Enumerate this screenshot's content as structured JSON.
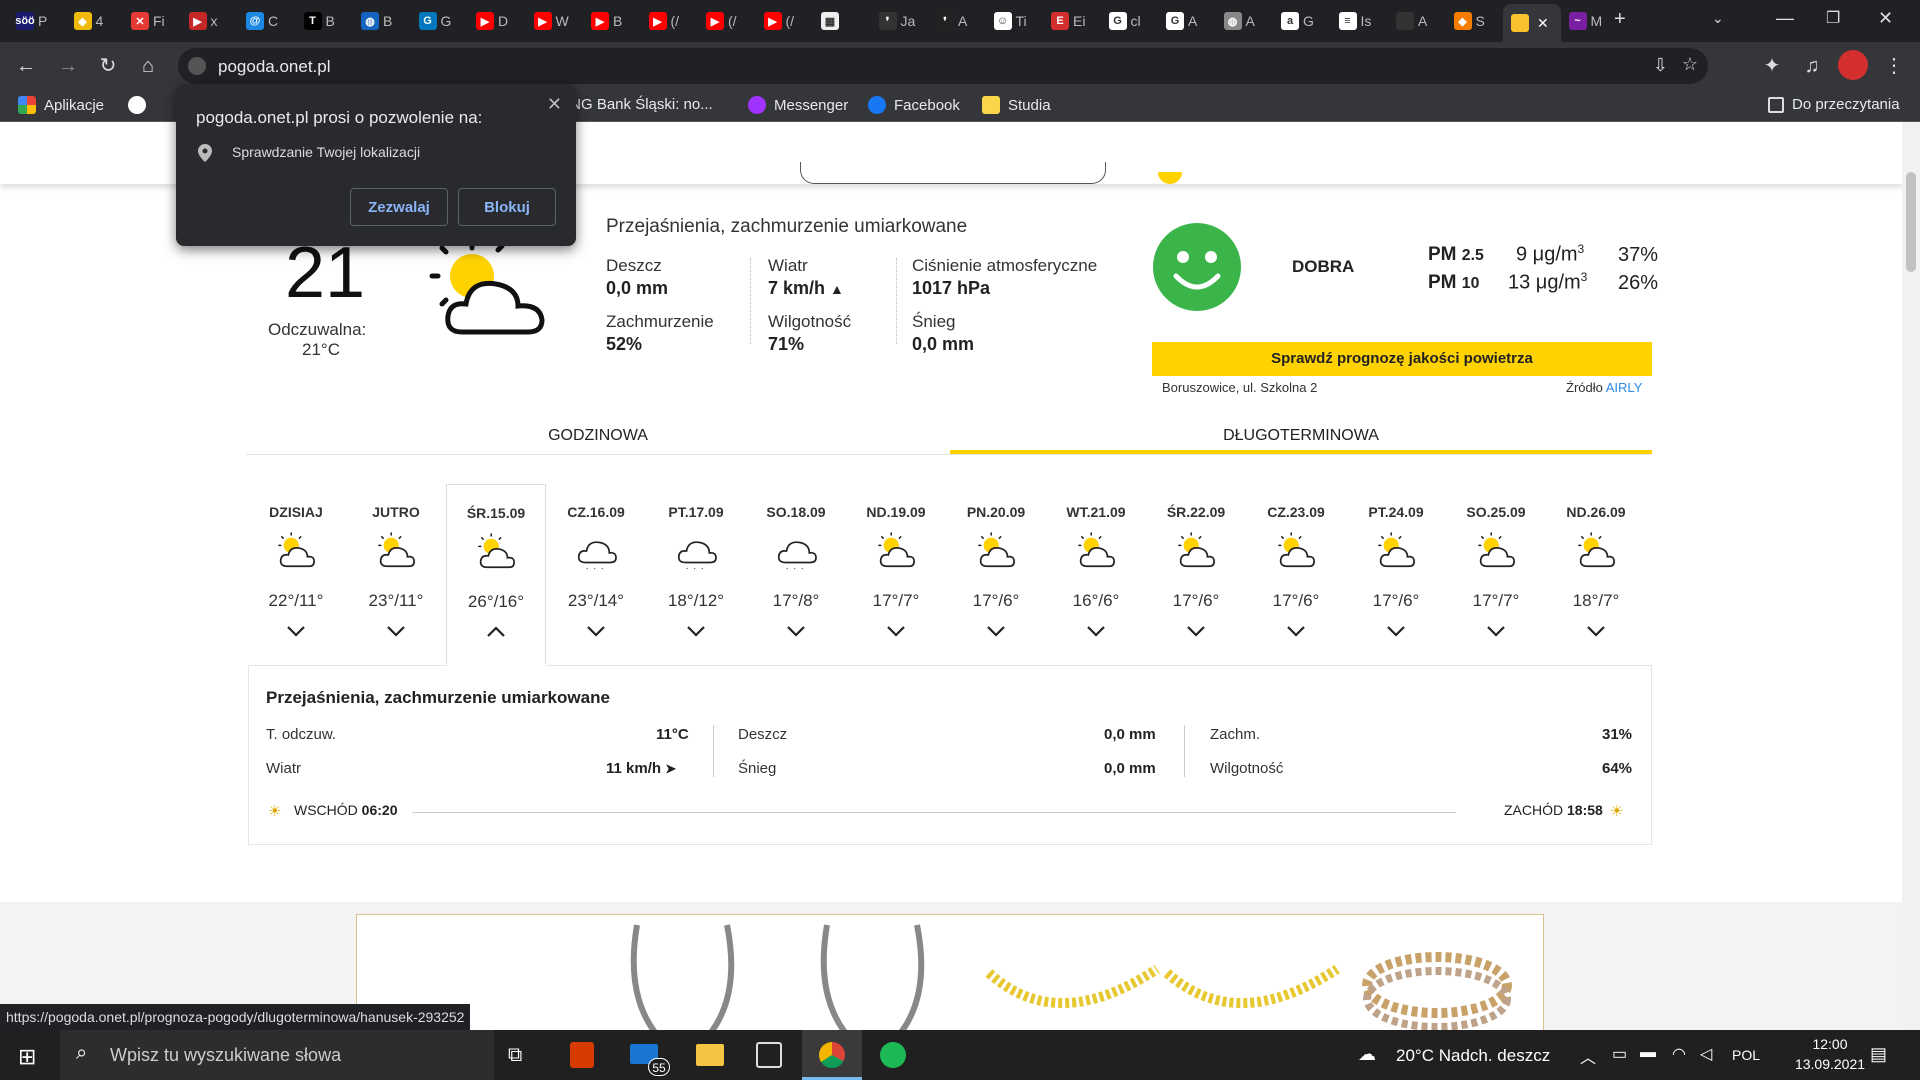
{
  "browser": {
    "tabs": [
      {
        "label": "P",
        "fav": "#1a1a6e",
        "glyph": "söö"
      },
      {
        "label": "4",
        "fav": "#f0b90b",
        "glyph": "◆"
      },
      {
        "label": "Fi",
        "fav": "#e53935",
        "glyph": "✕"
      },
      {
        "label": "x",
        "fav": "#c62828",
        "glyph": "▶"
      },
      {
        "label": "C",
        "fav": "#1e88e5",
        "glyph": "@"
      },
      {
        "label": "B",
        "fav": "#000",
        "glyph": "T"
      },
      {
        "label": "B",
        "fav": "#1565c0",
        "glyph": "◍"
      },
      {
        "label": "G",
        "fav": "#0277bd",
        "glyph": "G"
      },
      {
        "label": "D",
        "fav": "#f00",
        "glyph": "▶"
      },
      {
        "label": "W",
        "fav": "#f00",
        "glyph": "▶"
      },
      {
        "label": "B",
        "fav": "#f00",
        "glyph": "▶"
      },
      {
        "label": "(/",
        "fav": "#f00",
        "glyph": "▶"
      },
      {
        "label": "(/",
        "fav": "#f00",
        "glyph": "▶"
      },
      {
        "label": "(/",
        "fav": "#f00",
        "glyph": "▶"
      },
      {
        "label": "",
        "fav": "#eee",
        "glyph": "▦"
      },
      {
        "label": "Ja",
        "fav": "#333",
        "glyph": "❜"
      },
      {
        "label": "A",
        "fav": "#222",
        "glyph": "❜"
      },
      {
        "label": "Ti",
        "fav": "#fff",
        "glyph": "☺"
      },
      {
        "label": "Ei",
        "fav": "#d32f2f",
        "glyph": "E"
      },
      {
        "label": "cl",
        "fav": "#fff",
        "glyph": "G"
      },
      {
        "label": "A",
        "fav": "#fff",
        "glyph": "G"
      },
      {
        "label": "A",
        "fav": "#888",
        "glyph": "◍"
      },
      {
        "label": "G",
        "fav": "#fff",
        "glyph": "a"
      },
      {
        "label": "Is",
        "fav": "#fff",
        "glyph": "≡"
      },
      {
        "label": "A",
        "fav": "#333",
        "glyph": ""
      },
      {
        "label": "S",
        "fav": "#f57c00",
        "glyph": "◆"
      },
      {
        "label": "",
        "fav": "#fbc02d",
        "glyph": ""
      },
      {
        "label": "M",
        "fav": "#7b1fa2",
        "glyph": "~"
      }
    ],
    "url": "pogoda.onet.pl",
    "bookmarks": [
      "Aplikacje",
      "",
      "",
      "ING Bank Śląski: no...",
      "Messenger",
      "Facebook",
      "Studia"
    ],
    "reading_list": "Do przeczytania"
  },
  "permission": {
    "title": "pogoda.onet.pl prosi o pozwolenie na:",
    "item": "Sprawdzanie Twojej lokalizacji",
    "allow": "Zezwalaj",
    "block": "Blokuj"
  },
  "current": {
    "temp": "21",
    "feels_label": "Odczuwalna:",
    "feels": "21°C",
    "summary": "Przejaśnienia, zachmurzenie umiarkowane",
    "rain_label": "Deszcz",
    "rain": "0,0 mm",
    "wind_label": "Wiatr",
    "wind": "7 km/h",
    "pressure_label": "Ciśnienie atmosferyczne",
    "pressure": "1017 hPa",
    "cloud_label": "Zachmurzenie",
    "cloud": "52%",
    "humidity_label": "Wilgotność",
    "humidity": "71%",
    "snow_label": "Śnieg",
    "snow": "0,0 mm"
  },
  "air": {
    "rating": "DOBRA",
    "pm25_label": "PM",
    "pm25_sub": "2.5",
    "pm25_val": "9 μg/m",
    "pm25_pct": "37%",
    "pm10_label": "PM",
    "pm10_sub": "10",
    "pm10_val": "13 μg/m",
    "pm10_pct": "26%",
    "unit_sup": "3",
    "cta": "Sprawdź prognozę jakości powietrza",
    "location": "Boruszowice, ul. Szkolna 2",
    "source_label": "Źródło",
    "source": "AIRLY"
  },
  "tabs": {
    "hourly": "GODZINOWA",
    "longterm": "DŁUGOTERMINOWA"
  },
  "days": [
    {
      "label": "DZISIAJ",
      "temp": "22°/11°",
      "icon": "sun-cloud-icon",
      "open": false
    },
    {
      "label": "JUTRO",
      "temp": "23°/11°",
      "icon": "sun-cloud-icon",
      "open": false
    },
    {
      "label": "ŚR.15.09",
      "temp": "26°/16°",
      "icon": "sun-cloud-icon",
      "open": true
    },
    {
      "label": "CZ.16.09",
      "temp": "23°/14°",
      "icon": "rain-cloud-icon",
      "open": false
    },
    {
      "label": "PT.17.09",
      "temp": "18°/12°",
      "icon": "rain-cloud-icon",
      "open": false
    },
    {
      "label": "SO.18.09",
      "temp": "17°/8°",
      "icon": "rain-cloud-icon",
      "open": false
    },
    {
      "label": "ND.19.09",
      "temp": "17°/7°",
      "icon": "sun-cloud-icon",
      "open": false
    },
    {
      "label": "PN.20.09",
      "temp": "17°/6°",
      "icon": "sun-cloud-icon",
      "open": false
    },
    {
      "label": "WT.21.09",
      "temp": "16°/6°",
      "icon": "sun-cloud-icon",
      "open": false
    },
    {
      "label": "ŚR.22.09",
      "temp": "17°/6°",
      "icon": "sun-cloud-icon",
      "open": false
    },
    {
      "label": "CZ.23.09",
      "temp": "17°/6°",
      "icon": "sun-cloud-icon",
      "open": false
    },
    {
      "label": "PT.24.09",
      "temp": "17°/6°",
      "icon": "sun-cloud-icon",
      "open": false
    },
    {
      "label": "SO.25.09",
      "temp": "17°/7°",
      "icon": "sun-cloud-icon",
      "open": false
    },
    {
      "label": "ND.26.09",
      "temp": "18°/7°",
      "icon": "sun-cloud-icon",
      "open": false
    }
  ],
  "detail": {
    "summary": "Przejaśnienia, zachmurzenie umiarkowane",
    "feels_label": "T. odczuw.",
    "feels": "11°C",
    "wind_label": "Wiatr",
    "wind": "11 km/h",
    "rain_label": "Deszcz",
    "rain": "0,0 mm",
    "snow_label": "Śnieg",
    "snow": "0,0 mm",
    "cloud_label": "Zachm.",
    "cloud": "31%",
    "humidity_label": "Wilgotność",
    "humidity": "64%",
    "sunrise_label": "WSCHÓD",
    "sunrise": "06:20",
    "sunset_label": "ZACHÓD",
    "sunset": "18:58"
  },
  "status_url": "https://pogoda.onet.pl/prognoza-pogody/dlugoterminowa/hanusek-293252",
  "taskbar": {
    "search": "Wpisz tu wyszukiwane słowa",
    "mail_badge": "55",
    "weather": "20°C  Nadch. deszcz",
    "lang": "POL",
    "time": "12:00",
    "date": "13.09.2021"
  },
  "colors": {
    "accent": "#ffd200",
    "green": "#3bb54a",
    "link": "#2d8ae6"
  }
}
